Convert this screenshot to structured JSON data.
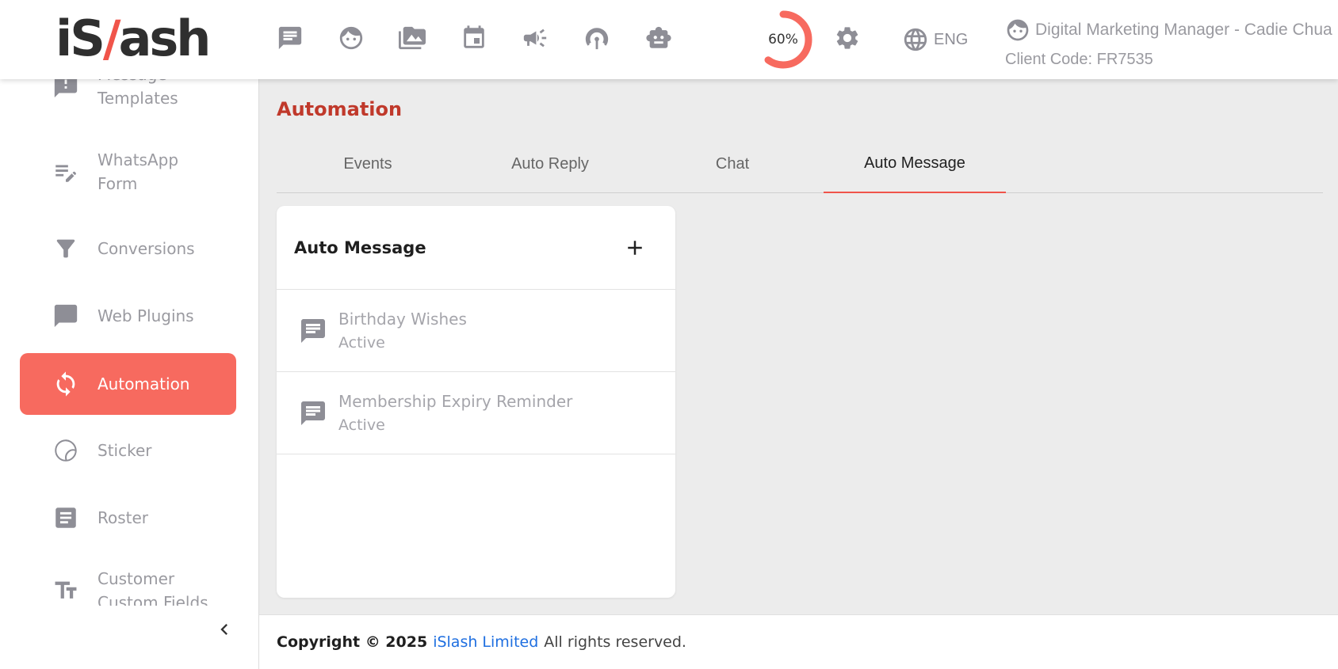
{
  "header": {
    "logo_prefix": "iS",
    "logo_slash": "/",
    "logo_suffix": "ash",
    "nav_icons": [
      "chat-icon",
      "face-icon",
      "media-icon",
      "calendar-icon",
      "campaign-icon",
      "podcast-icon",
      "bot-icon"
    ],
    "progress_percent": 60,
    "progress_label": "60%",
    "language": "ENG",
    "user_title": "Digital Marketing Manager - Cadie Chua",
    "client_code": "Client Code: FR7535",
    "accent_color": "#f76a5f"
  },
  "sidebar": {
    "items": [
      {
        "label": "Message Templates",
        "icon": "message-alert-icon"
      },
      {
        "label": "WhatsApp Form",
        "icon": "form-edit-icon"
      },
      {
        "label": "Conversions",
        "icon": "filter-icon"
      },
      {
        "label": "Web Plugins",
        "icon": "chat-bubble-icon"
      },
      {
        "label": "Automation",
        "icon": "sync-icon",
        "active": true
      },
      {
        "label": "Sticker",
        "icon": "sticker-icon"
      },
      {
        "label": "Roster",
        "icon": "roster-icon"
      },
      {
        "label": "Customer Custom Fields",
        "icon": "text-size-icon"
      }
    ]
  },
  "main": {
    "page_title": "Automation",
    "tabs": [
      {
        "label": "Events"
      },
      {
        "label": "Auto Reply"
      },
      {
        "label": "Chat"
      },
      {
        "label": "Auto Message",
        "active": true
      }
    ],
    "card": {
      "title": "Auto Message",
      "items": [
        {
          "name": "Birthday Wishes",
          "status": "Active"
        },
        {
          "name": "Membership Expiry Reminder",
          "status": "Active"
        }
      ]
    }
  },
  "footer": {
    "copyright": "Copyright © 2025",
    "company": "iSlash Limited",
    "rights": "All rights reserved."
  }
}
